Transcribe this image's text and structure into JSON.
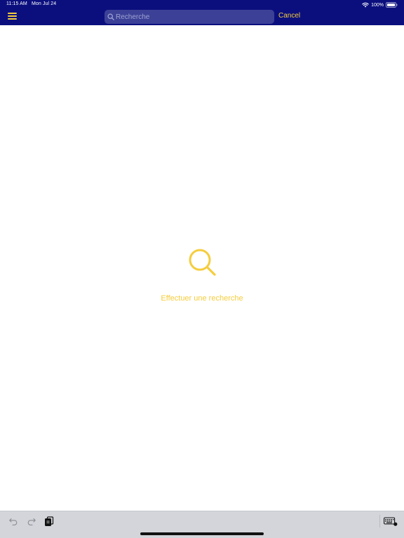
{
  "status_bar": {
    "time": "11:15 AM",
    "date": "Mon Jul 24",
    "battery": "100%",
    "icons": [
      "wifi-icon",
      "battery-icon"
    ]
  },
  "nav": {
    "menu_icon": "hamburger-menu-icon",
    "search": {
      "placeholder": "Recherche",
      "value": "",
      "icon": "search-icon"
    },
    "cancel_label": "Cancel"
  },
  "empty_state": {
    "icon": "search-icon",
    "message": "Effectuer une recherche"
  },
  "bottom_bar": {
    "icons": [
      "undo-icon",
      "redo-icon",
      "paste-icon",
      "keyboard-icon"
    ]
  },
  "colors": {
    "header_bg": "#0b0f7e",
    "accent": "#f5cd3d",
    "search_field_bg": "#3c4197",
    "bottom_bar_bg": "#d3d5da"
  }
}
